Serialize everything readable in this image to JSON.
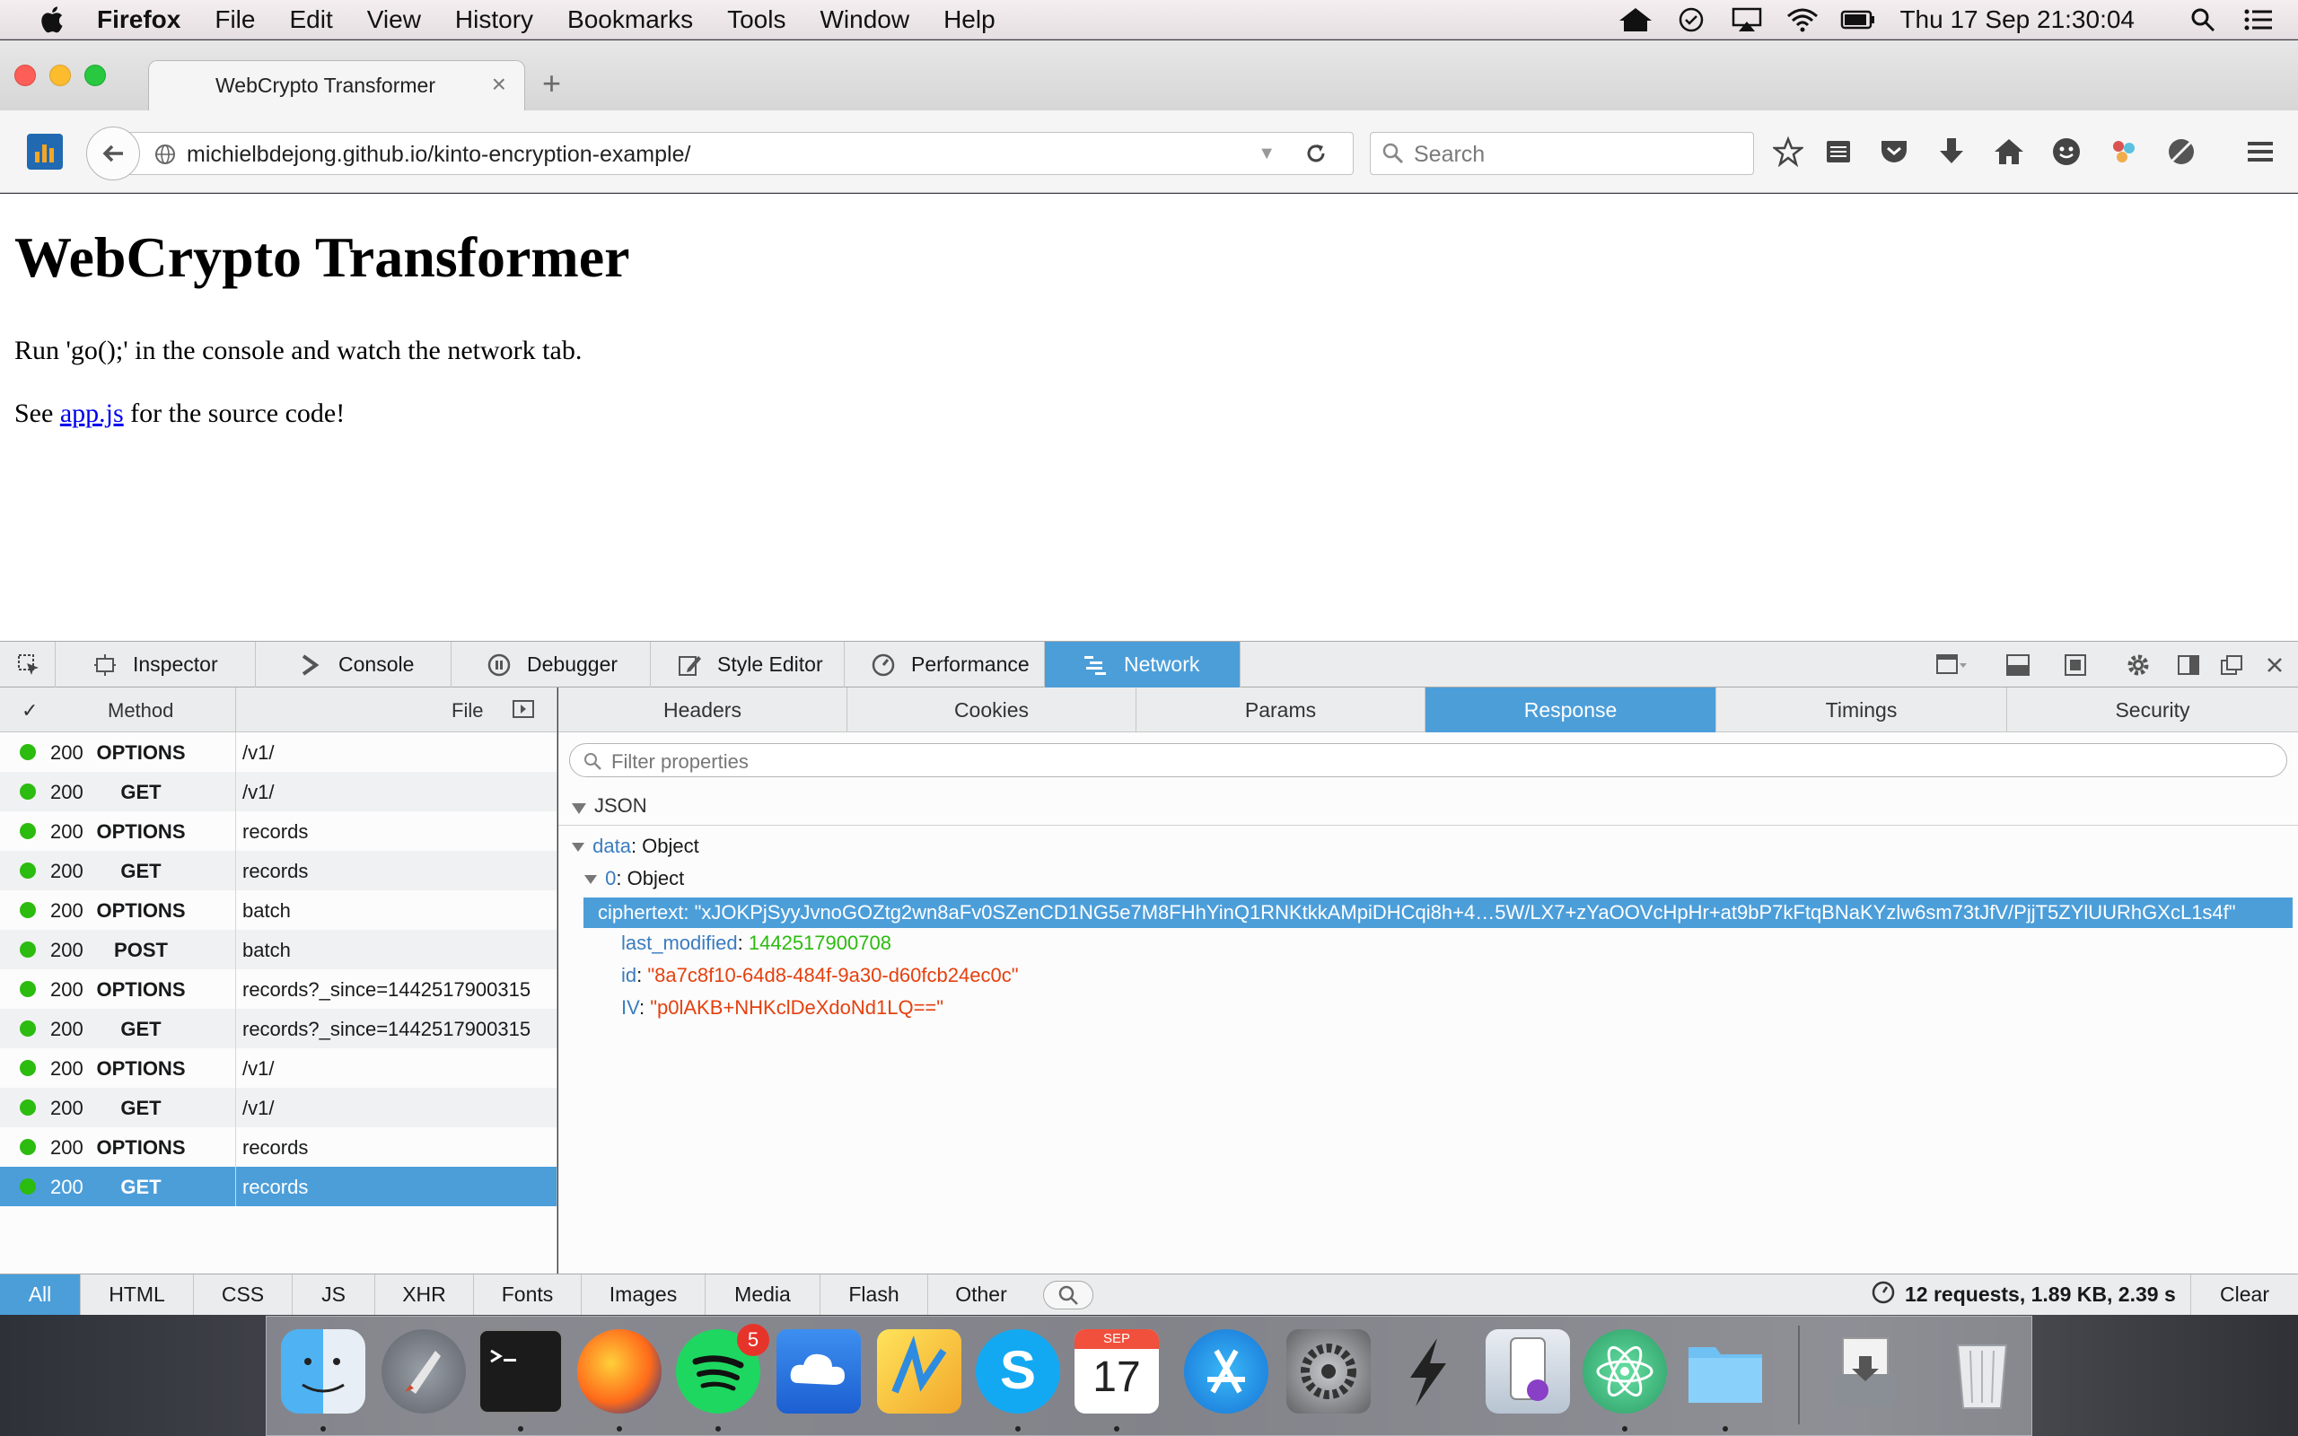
{
  "menubar": {
    "app_name": "Firefox",
    "items": [
      "File",
      "Edit",
      "View",
      "History",
      "Bookmarks",
      "Tools",
      "Window",
      "Help"
    ],
    "clock": "Thu 17 Sep  21:30:04"
  },
  "browser": {
    "tab_title": "WebCrypto Transformer",
    "url": "michielbdejong.github.io/kinto-encryption-example/",
    "search_placeholder": "Search"
  },
  "page": {
    "heading": "WebCrypto Transformer",
    "para1": "Run 'go();' in the console and watch the network tab.",
    "para2_before": "See ",
    "para2_link": "app.js",
    "para2_after": " for the source code!"
  },
  "devtools": {
    "tabs": [
      "Inspector",
      "Console",
      "Debugger",
      "Style Editor",
      "Performance",
      "Network"
    ],
    "active_tab": "Network",
    "columns": {
      "check": "✓",
      "method": "Method",
      "file": "File"
    },
    "requests": [
      {
        "status": "200",
        "method": "OPTIONS",
        "file": "/v1/"
      },
      {
        "status": "200",
        "method": "GET",
        "file": "/v1/"
      },
      {
        "status": "200",
        "method": "OPTIONS",
        "file": "records"
      },
      {
        "status": "200",
        "method": "GET",
        "file": "records"
      },
      {
        "status": "200",
        "method": "OPTIONS",
        "file": "batch"
      },
      {
        "status": "200",
        "method": "POST",
        "file": "batch"
      },
      {
        "status": "200",
        "method": "OPTIONS",
        "file": "records?_since=1442517900315"
      },
      {
        "status": "200",
        "method": "GET",
        "file": "records?_since=1442517900315"
      },
      {
        "status": "200",
        "method": "OPTIONS",
        "file": "/v1/"
      },
      {
        "status": "200",
        "method": "GET",
        "file": "/v1/"
      },
      {
        "status": "200",
        "method": "OPTIONS",
        "file": "records"
      },
      {
        "status": "200",
        "method": "GET",
        "file": "records"
      }
    ],
    "detail_tabs": [
      "Headers",
      "Cookies",
      "Params",
      "Response",
      "Timings",
      "Security"
    ],
    "active_detail_tab": "Response",
    "filter_placeholder": "Filter properties",
    "json_label": "JSON",
    "json": {
      "data_key": "data",
      "data_type": ": Object",
      "index_key": "0",
      "index_type": ": Object",
      "cipher_key": "ciphertext",
      "cipher_value": ": \"xJOKPjSyyJvnoGOZtg2wn8aFv0SZenCD1NG5e7M8FHhYinQ1RNKtkkAMpiDHCqi8h+4…5W/LX7+zYaOOVcHpHr+at9bP7kFtqBNaKYzlw6sm73tJfV/PjjT5ZYlUURhGXcL1s4f\"",
      "lastmod_key": "last_modified",
      "lastmod_value": "1442517900708",
      "id_key": "id",
      "id_value": "\"8a7c8f10-64d8-484f-9a30-d60fcb24ec0c\"",
      "iv_key": "IV",
      "iv_value": "\"p0lAKB+NHKclDeXdoNd1LQ==\""
    },
    "type_filters": [
      "All",
      "HTML",
      "CSS",
      "JS",
      "XHR",
      "Fonts",
      "Images",
      "Media",
      "Flash",
      "Other"
    ],
    "active_filter": "All",
    "summary": "12 requests, 1.89 KB, 2.39 s",
    "clear_label": "Clear"
  },
  "dock": {
    "apps": [
      "finder-icon",
      "launchpad-icon",
      "terminal-icon",
      "firefox-icon",
      "spotify-icon",
      "cloud-app-icon",
      "maps-app-icon",
      "skype-icon",
      "calendar-icon",
      "app-store-icon",
      "system-preferences-icon",
      "reeder-icon",
      "simulator-icon",
      "atom-icon",
      "folder-icon",
      "downloads-icon",
      "trash-icon"
    ],
    "spotify_badge": "5",
    "calendar_month": "SEP",
    "calendar_day": "17"
  },
  "colors": {
    "accent": "#4c9ed9",
    "status_ok": "#2cbb0f",
    "json_key": "#3a7cbf",
    "json_string": "#e5400e"
  }
}
